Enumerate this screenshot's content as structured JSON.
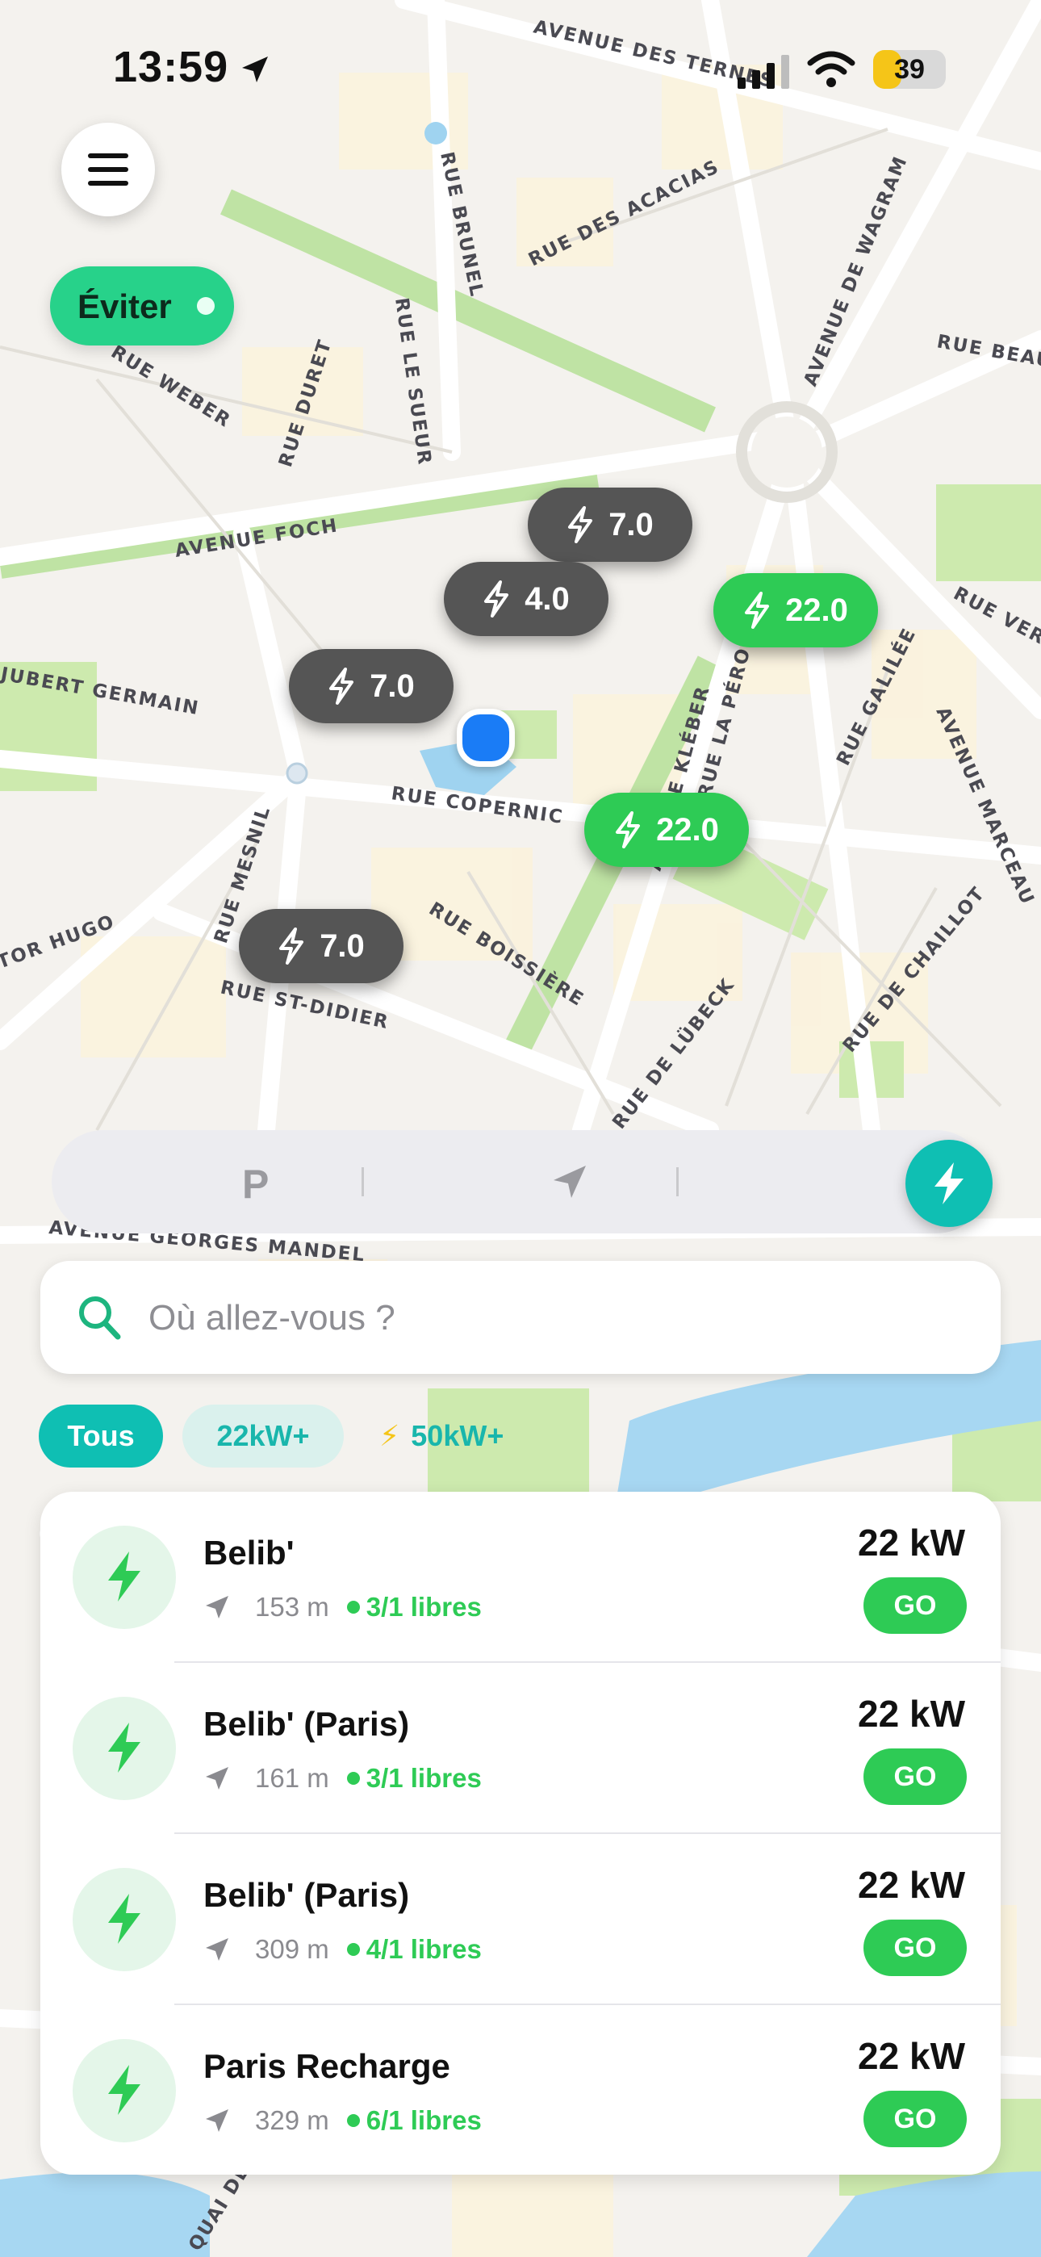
{
  "status_bar": {
    "time": "13:59",
    "battery": "39"
  },
  "map": {
    "streets": [
      "AVENUE DES TERNES",
      "AVENUE DE WAGRAM",
      "RUE DES ACACIAS",
      "RUE BRUNEL",
      "AVENUE FOCH",
      "RUE LE SUEUR",
      "RUE DURET",
      "RUE WEBER",
      "RUE COPERNIC",
      "RUE BOISSIÈRE",
      "RUE ST-DIDIER",
      "RUE MESNIL",
      "AVENUE KLÉBER",
      "RUE LA PÉROUSE",
      "RUE GALILÉE",
      "AVENUE MARCEAU",
      "RUE DE CHAILLOT",
      "AVENUE GEORGES MANDEL",
      "QUAI DE",
      "RUE DE LÜBECK",
      "RUE VERN",
      "RUE BEAU",
      "JUBERT GERMAIN",
      "TOR HUGO"
    ],
    "pins": [
      {
        "label": "7.0",
        "style": "dark"
      },
      {
        "label": "4.0",
        "style": "dark"
      },
      {
        "label": "7.0",
        "style": "dark"
      },
      {
        "label": "22.0",
        "style": "green"
      },
      {
        "label": "22.0",
        "style": "green"
      },
      {
        "label": "7.0",
        "style": "dark"
      }
    ]
  },
  "controls": {
    "avoid_label": "Éviter",
    "mode_parking": "P"
  },
  "search": {
    "placeholder": "Où allez-vous ?"
  },
  "filters": {
    "all": "Tous",
    "kw22": "22kW+",
    "kw50": "50kW+"
  },
  "stations": [
    {
      "name": "Belib'",
      "distance": "153 m",
      "availability": "3/1 libres",
      "power": "22 kW",
      "action": "GO"
    },
    {
      "name": "Belib' (Paris)",
      "distance": "161 m",
      "availability": "3/1 libres",
      "power": "22 kW",
      "action": "GO"
    },
    {
      "name": "Belib' (Paris)",
      "distance": "309 m",
      "availability": "4/1 libres",
      "power": "22 kW",
      "action": "GO"
    },
    {
      "name": "Paris Recharge",
      "distance": "329 m",
      "availability": "6/1 libres",
      "power": "22 kW",
      "action": "GO"
    }
  ],
  "colors": {
    "accent_teal": "#0fbfb3",
    "green": "#2ecb55",
    "pin_dark": "#555555",
    "user_location": "#1a7cf6"
  }
}
